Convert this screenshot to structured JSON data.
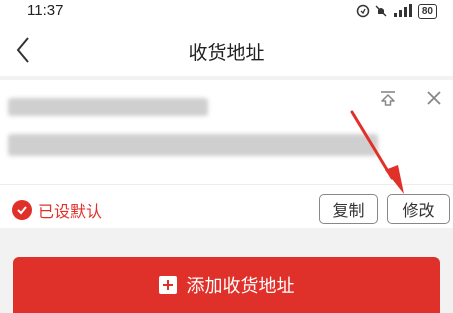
{
  "status_bar": {
    "time": "11:37",
    "icons": [
      "nfc-icon",
      "mute-icon",
      "signal-icon",
      "battery-icon"
    ],
    "battery": "80"
  },
  "header": {
    "title": "收货地址"
  },
  "address_card": {
    "default_label": "已设默认",
    "copy_label": "复制",
    "edit_label": "修改"
  },
  "footer": {
    "add_label": "添加收货地址"
  },
  "colors": {
    "accent": "#e0302a",
    "background": "#f2f2f2"
  }
}
